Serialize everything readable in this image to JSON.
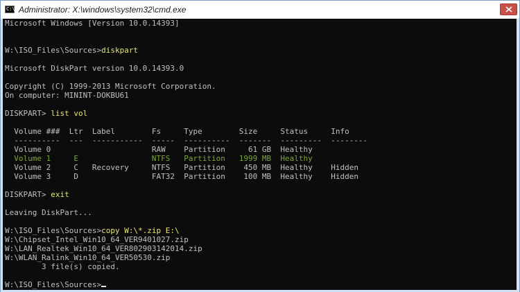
{
  "window": {
    "title": "Administrator: X:\\windows\\system32\\cmd.exe",
    "icon": "cmd-icon",
    "icon_glyph": "C:\\",
    "close_icon": "close-icon"
  },
  "console": {
    "lines": [
      {
        "text": "Microsoft Windows [Version 10.0.14393]"
      },
      {
        "text": ""
      },
      {
        "text": ""
      },
      {
        "prompt": "W:\\ISO_Files\\Sources>",
        "cmd": "diskpart"
      },
      {
        "text": ""
      },
      {
        "text": "Microsoft DiskPart version 10.0.14393.0"
      },
      {
        "text": ""
      },
      {
        "text": "Copyright (C) 1999-2013 Microsoft Corporation."
      },
      {
        "text": "On computer: MININT-DOKBU61"
      },
      {
        "text": ""
      },
      {
        "prompt": "DISKPART> ",
        "cmd": "list vol"
      },
      {
        "text": ""
      },
      {
        "text": "  Volume ###  Ltr  Label        Fs     Type        Size     Status     Info"
      },
      {
        "text": "  ----------  ---  -----------  -----  ----------  -------  ---------  --------"
      },
      {
        "text": "  Volume 0                      RAW    Partition     61 GB  Healthy"
      },
      {
        "text": "  Volume 1     E                NTFS   Partition   1999 MB  Healthy",
        "highlight": true
      },
      {
        "text": "  Volume 2     C   Recovery     NTFS   Partition    450 MB  Healthy    Hidden"
      },
      {
        "text": "  Volume 3     D                FAT32  Partition    100 MB  Healthy    Hidden"
      },
      {
        "text": ""
      },
      {
        "prompt": "DISKPART> ",
        "cmd": "exit"
      },
      {
        "text": ""
      },
      {
        "text": "Leaving DiskPart..."
      },
      {
        "text": ""
      },
      {
        "prompt": "W:\\ISO_Files\\Sources>",
        "cmd": "copy W:\\*.zip E:\\"
      },
      {
        "text": "W:\\Chipset_Intel_Win10_64_VER9401027.zip"
      },
      {
        "text": "W:\\LAN_Realtek_Win10_64_VER802903142014.zip"
      },
      {
        "text": "W:\\WLAN_Ralink_Win10_64_VER50530.zip"
      },
      {
        "text": "        3 file(s) copied."
      },
      {
        "text": ""
      },
      {
        "prompt": "W:\\ISO_Files\\Sources>",
        "cmd": "",
        "cursor": true
      }
    ]
  },
  "colors": {
    "console_bg": "#0c0c0c",
    "text": "#c0c0c0",
    "command": "#e6e67a",
    "highlight_row": "#7ea33e",
    "close_button": "#c7504a"
  }
}
